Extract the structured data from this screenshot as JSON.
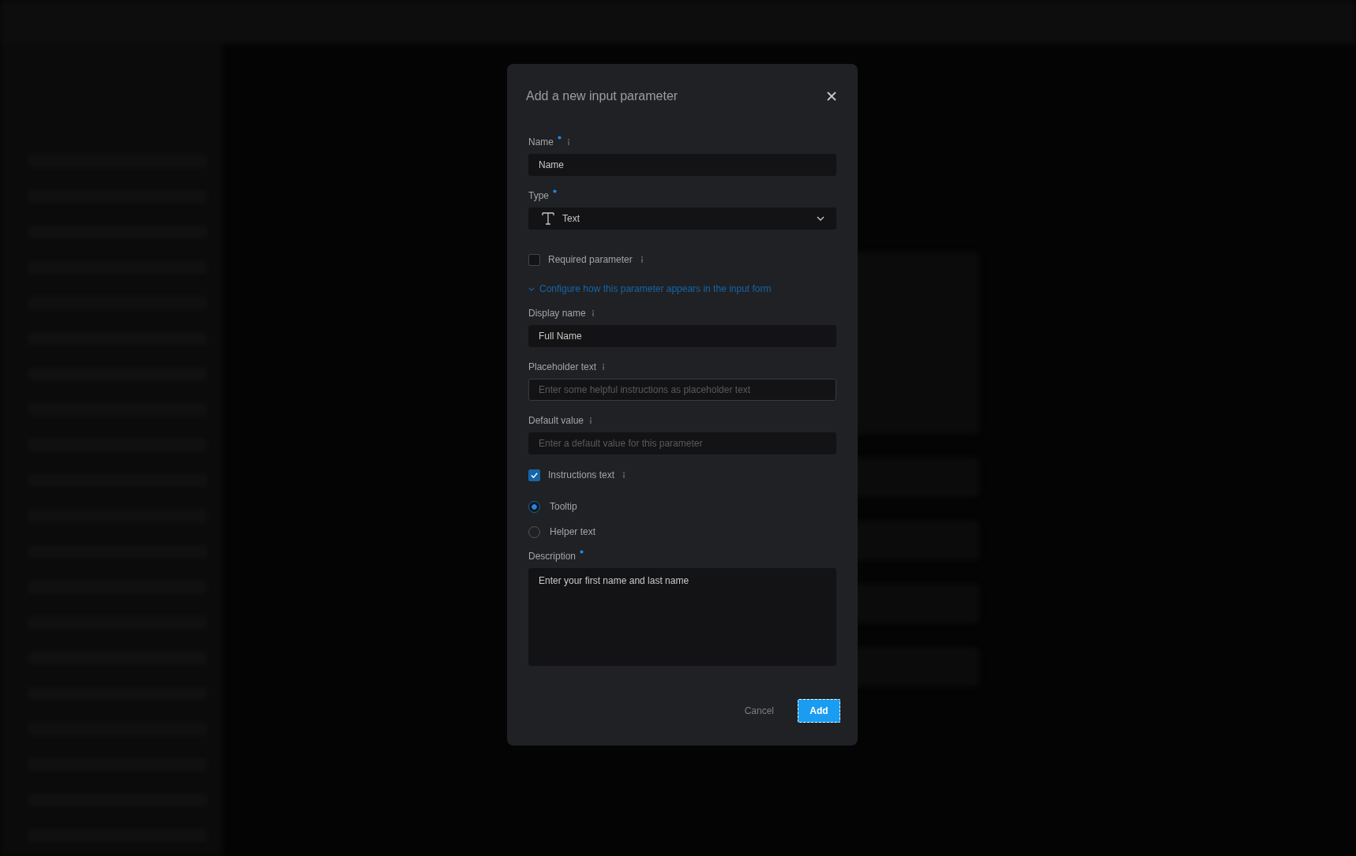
{
  "dialog": {
    "title": "Add a new input parameter",
    "fields": [
      {
        "kind": "input",
        "label": "Name",
        "required": true,
        "info": true,
        "value": "Name",
        "focused": false
      },
      {
        "kind": "select",
        "label": "Type",
        "required": true,
        "info": false,
        "value": "Text"
      },
      {
        "kind": "checkbox",
        "label": "Required parameter",
        "info": true,
        "checked": false
      },
      {
        "kind": "disclosure",
        "label": "Configure how this parameter appears in the input form",
        "expanded": true
      },
      {
        "kind": "input",
        "label": "Display name",
        "required": false,
        "info": true,
        "value": "Full Name",
        "focused": false
      },
      {
        "kind": "input",
        "label": "Placeholder text",
        "required": false,
        "info": true,
        "placeholder": "Enter some helpful instructions as placeholder text",
        "focused": true
      },
      {
        "kind": "input",
        "label": "Default value",
        "required": false,
        "info": true,
        "placeholder": "Enter a default value for this parameter",
        "focused": false
      },
      {
        "kind": "checkbox",
        "label": "Instructions text",
        "info": true,
        "checked": true
      },
      {
        "kind": "radio",
        "label": "Tooltip",
        "selected": true
      },
      {
        "kind": "radio",
        "label": "Helper text",
        "selected": false
      },
      {
        "kind": "textarea",
        "label": "Description",
        "required": true,
        "info": false,
        "value": "Enter your first name and last name"
      }
    ],
    "buttons": [
      {
        "kind": "secondary",
        "label": "Cancel"
      },
      {
        "kind": "primary",
        "label": "Add"
      }
    ]
  }
}
